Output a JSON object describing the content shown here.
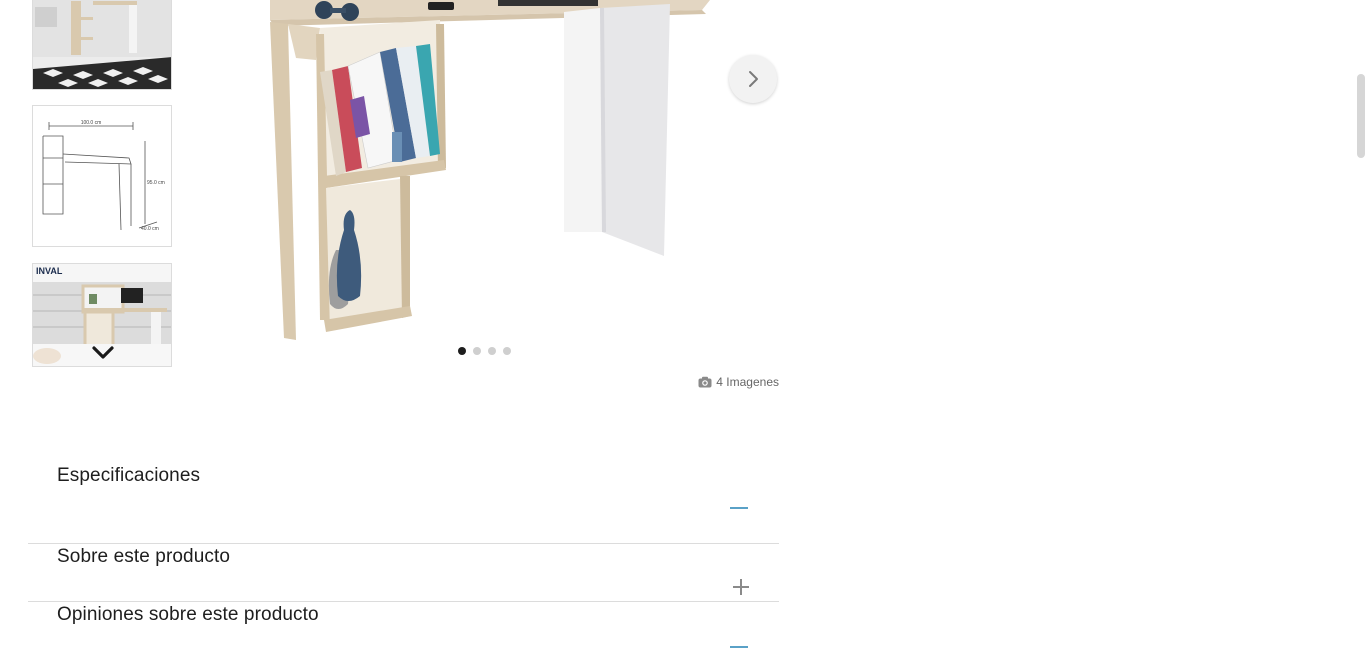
{
  "gallery": {
    "thumbnails": [
      {
        "icon": "desk-room-photo"
      },
      {
        "icon": "desk-dimension-diagram",
        "labels": [
          "100.0 cm",
          "95.0 cm",
          "40.0 cm"
        ]
      },
      {
        "icon": "desk-room-photo-branded",
        "brand": "INVAL"
      }
    ],
    "main_image": {
      "icon": "desk-product-photo"
    },
    "slide_count": 4,
    "active_slide": 1,
    "image_count_label": "4 Imagenes"
  },
  "accordion": [
    {
      "title": "Especificaciones",
      "state": "expanded"
    },
    {
      "title": "Sobre este producto",
      "state": "collapsed"
    },
    {
      "title": "Opiniones sobre este producto",
      "state": "expanded"
    }
  ],
  "colors": {
    "accent": "#5aa1c7",
    "dot_active": "#1d1d1d",
    "dot_inactive": "#cfcfcf"
  }
}
